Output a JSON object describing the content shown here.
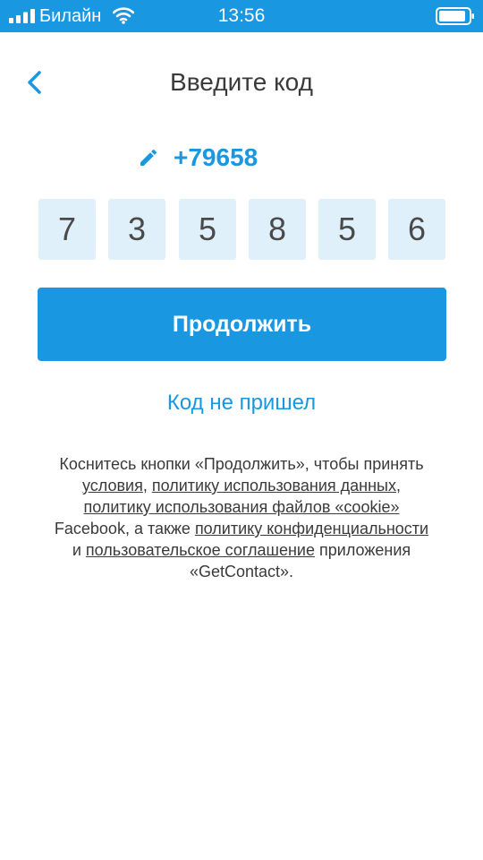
{
  "status_bar": {
    "carrier": "Билайн",
    "time": "13:56"
  },
  "header": {
    "title": "Введите код"
  },
  "phone": {
    "number": "+79658"
  },
  "code": {
    "digits": [
      "7",
      "3",
      "5",
      "8",
      "5",
      "6"
    ]
  },
  "continue_label": "Продолжить",
  "resend_label": "Код не пришел",
  "terms": {
    "t1": "Коснитесь кнопки «Продолжить», чтобы принять ",
    "link_terms": "условия",
    "sep1": ", ",
    "link_data_policy": "политику использования данных",
    "sep2": ", ",
    "link_cookie_policy": "политику использования файлов «cookie»",
    "t2": " Facebook, а также ",
    "link_privacy_policy": "политику конфиденциальности",
    "t3": " и ",
    "link_user_agreement": "пользовательское соглашение",
    "t4": " приложения «GetContact»."
  },
  "colors": {
    "accent": "#1a97e1",
    "code_box_bg": "#dff0fb",
    "text_dark": "#3a3a3a"
  }
}
